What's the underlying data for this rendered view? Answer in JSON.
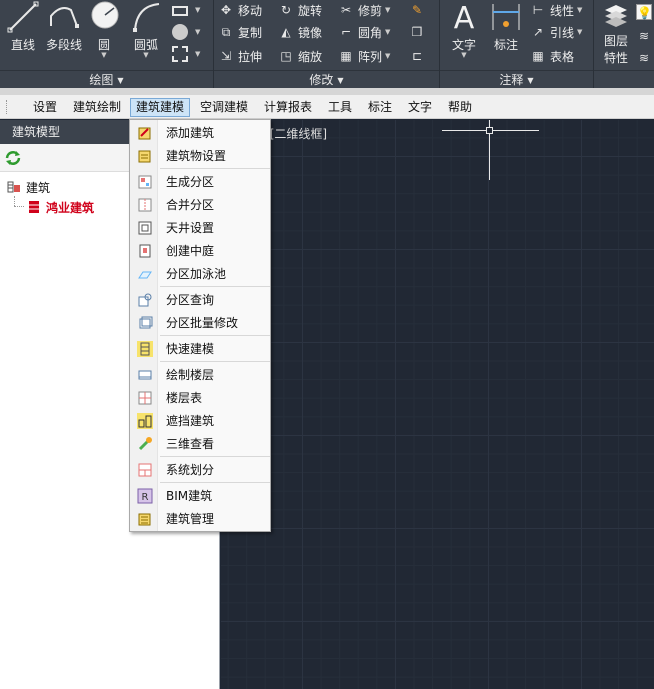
{
  "ribbon": {
    "groups": {
      "draw": "绘图",
      "modify": "修改",
      "annotate": "注释"
    },
    "draw_tools": {
      "line": "直线",
      "polyline": "多段线",
      "circle": "圆",
      "arc": "圆弧"
    },
    "modify_tools": {
      "move": "移动",
      "rotate": "旋转",
      "trim": "修剪",
      "copy": "复制",
      "mirror": "镜像",
      "fillet": "圆角",
      "stretch": "拉伸",
      "scale": "缩放",
      "array": "阵列"
    },
    "annotate_tools": {
      "text": "文字",
      "dimension": "标注",
      "linear": "线性",
      "leader": "引线",
      "table": "表格"
    },
    "layers": {
      "layer_props_line1": "图层",
      "layer_props_line2": "特性"
    }
  },
  "menubar": {
    "items": [
      "设置",
      "建筑绘制",
      "建筑建模",
      "空调建模",
      "计算报表",
      "工具",
      "标注",
      "文字",
      "帮助"
    ],
    "active": "建筑建模"
  },
  "panel": {
    "title": "建筑模型",
    "tree_root": "建筑",
    "tree_child": "鸿业建筑"
  },
  "viewport": {
    "label": "]|[二维线框]"
  },
  "dropdown": {
    "items": [
      {
        "label": "添加建筑",
        "icon": "add-building-icon"
      },
      {
        "label": "建筑物设置",
        "icon": "building-settings-icon"
      },
      {
        "label": "生成分区",
        "icon": "generate-zone-icon"
      },
      {
        "label": "合并分区",
        "icon": "merge-zone-icon"
      },
      {
        "label": "天井设置",
        "icon": "atrium-settings-icon"
      },
      {
        "label": "创建中庭",
        "icon": "create-courtyard-icon"
      },
      {
        "label": "分区加泳池",
        "icon": "zone-pool-icon"
      },
      {
        "label": "分区查询",
        "icon": "zone-query-icon"
      },
      {
        "label": "分区批量修改",
        "icon": "zone-batch-edit-icon"
      },
      {
        "label": "快速建模",
        "icon": "quick-model-icon"
      },
      {
        "label": "绘制楼层",
        "icon": "draw-floor-icon"
      },
      {
        "label": "楼层表",
        "icon": "floor-table-icon"
      },
      {
        "label": "遮挡建筑",
        "icon": "shading-building-icon"
      },
      {
        "label": "三维查看",
        "icon": "3d-view-icon"
      },
      {
        "label": "系统划分",
        "icon": "system-division-icon"
      },
      {
        "label": "BIM建筑",
        "icon": "bim-building-icon"
      },
      {
        "label": "建筑管理",
        "icon": "building-management-icon"
      }
    ]
  },
  "colors": {
    "ribbon_bg": "#3c434d",
    "canvas_bg": "#212834",
    "highlight": "#cde4f7",
    "tree_child": "#d0021b"
  }
}
